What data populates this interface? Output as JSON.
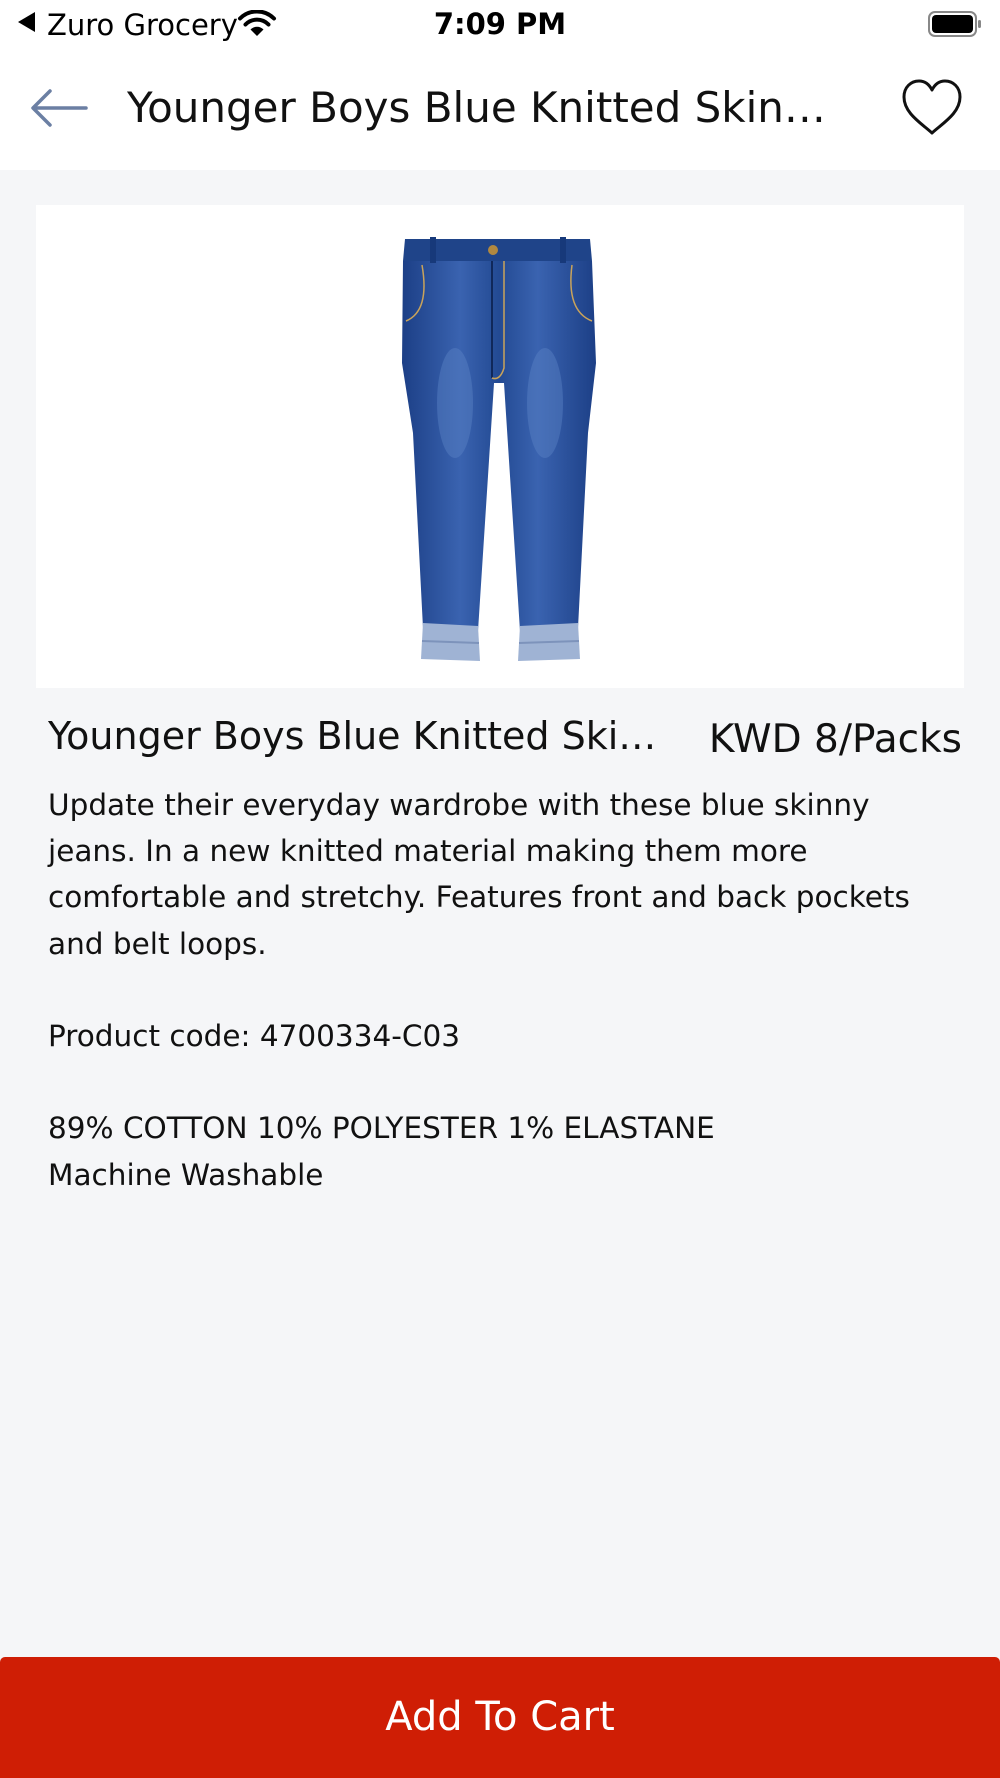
{
  "status_bar": {
    "app_name": "Zuro Grocery",
    "time": "7:09 PM"
  },
  "header": {
    "title": "Younger Boys Blue Knitted Skinny Jeans",
    "back_icon": "back-arrow-icon",
    "favorite_icon": "heart-outline-icon"
  },
  "product": {
    "name": "Younger Boys Blue Knitted Skinny Jeans",
    "price": "KWD 8/Packs",
    "description": "Update their everyday wardrobe with these blue skinny jeans. In a new knitted material making them more comfortable and stretchy. Features front and back pockets and belt loops.",
    "product_code": "Product code: 4700334-C03",
    "material": "89% COTTON 10% POLYESTER 1% ELASTANE",
    "care": "Machine Washable"
  },
  "actions": {
    "add_to_cart_label": "Add To Cart"
  },
  "colors": {
    "accent": "#cf1e05",
    "background": "#f5f6f8",
    "back_arrow": "#6b7fa3"
  }
}
